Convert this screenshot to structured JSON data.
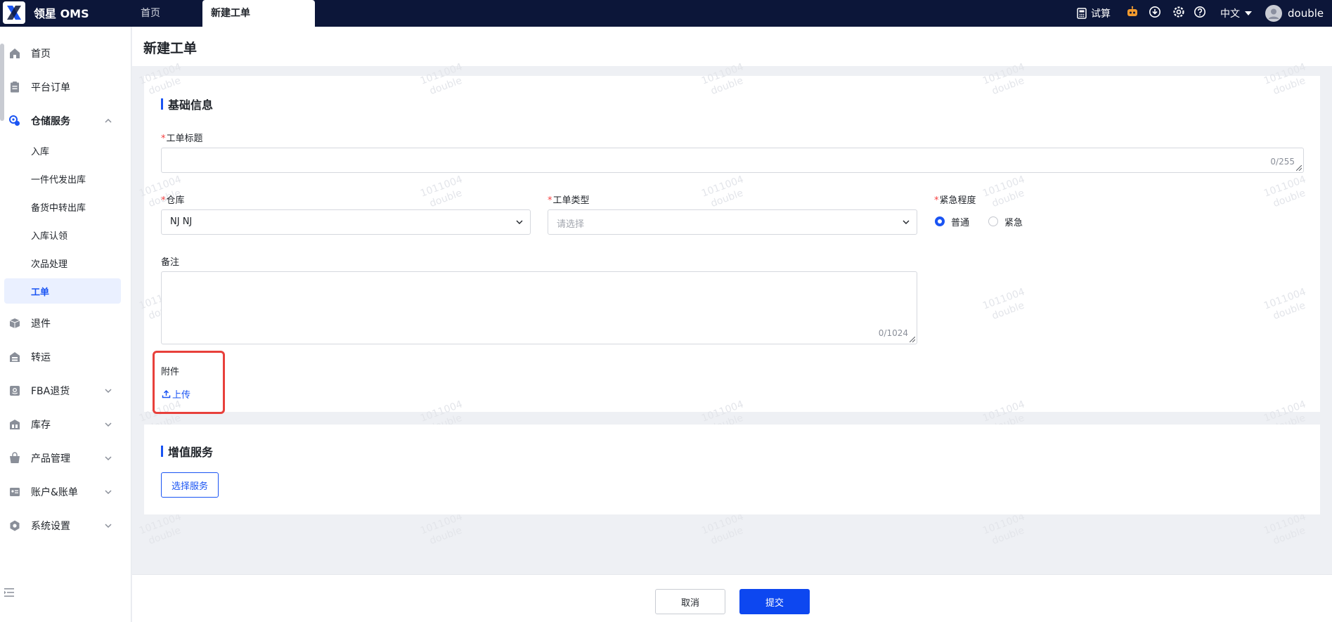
{
  "app": {
    "brand": "领星 OMS",
    "tabs": [
      {
        "label": "首页"
      },
      {
        "label": "新建工单"
      }
    ],
    "topbar": {
      "trial_calc": "试算",
      "language": "中文",
      "username": "double"
    }
  },
  "sidebar": {
    "items": [
      {
        "label": "首页",
        "icon": "home-icon"
      },
      {
        "label": "平台订单",
        "icon": "clipboard-icon"
      },
      {
        "label": "仓储服务",
        "icon": "warehouse-service-icon"
      },
      {
        "label": "退件",
        "icon": "return-box-icon"
      },
      {
        "label": "转运",
        "icon": "transfer-icon"
      },
      {
        "label": "FBA退货",
        "icon": "amazon-icon"
      },
      {
        "label": "库存",
        "icon": "inventory-icon"
      },
      {
        "label": "产品管理",
        "icon": "product-icon"
      },
      {
        "label": "账户&账单",
        "icon": "account-icon"
      },
      {
        "label": "系统设置",
        "icon": "settings-hex-icon"
      }
    ],
    "sub_items": [
      {
        "label": "入库"
      },
      {
        "label": "一件代发出库"
      },
      {
        "label": "备货中转出库"
      },
      {
        "label": "入库认领"
      },
      {
        "label": "次品处理"
      },
      {
        "label": "工单"
      }
    ]
  },
  "page": {
    "title": "新建工单",
    "basic_section": {
      "title": "基础信息",
      "ticket_title_label": "工单标题",
      "ticket_title_counter": "0/255",
      "warehouse_label": "仓库",
      "warehouse_value": "NJ NJ",
      "type_label": "工单类型",
      "type_placeholder": "请选择",
      "urgency_label": "紧急程度",
      "urgency_options": [
        "普通",
        "紧急"
      ],
      "urgency_selected": "普通",
      "remark_label": "备注",
      "remark_counter": "0/1024",
      "attachment_label": "附件",
      "upload_label": "上传"
    },
    "value_added_section": {
      "title": "增值服务",
      "select_service_label": "选择服务"
    },
    "footer": {
      "cancel_label": "取消",
      "submit_label": "提交"
    },
    "watermark": {
      "line1": "1011004",
      "line2": "double"
    }
  },
  "colors": {
    "topbar_bg": "#0c1639",
    "accent": "#1a54f3",
    "primary_button": "#0d47f0",
    "required": "#f53f3f",
    "highlight_box": "#e8403b"
  }
}
